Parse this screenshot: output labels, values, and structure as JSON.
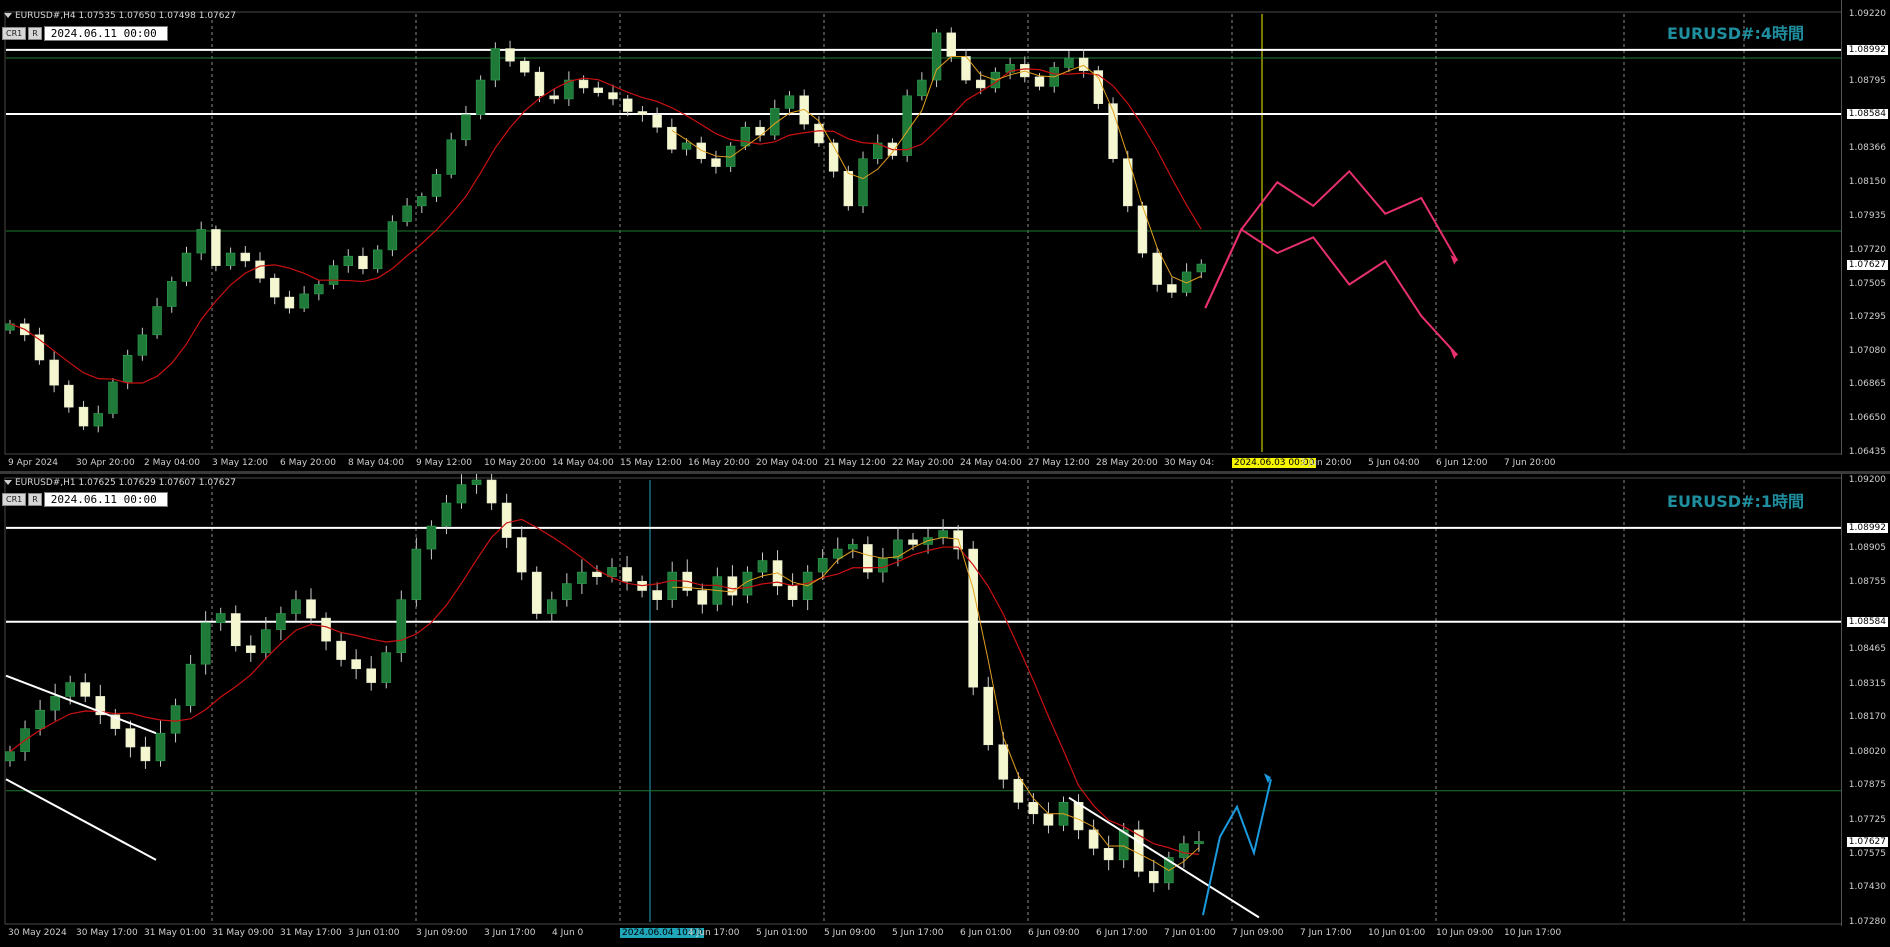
{
  "top": {
    "header": "EURUSD#,H4  1.07535 1.07650 1.07498 1.07627",
    "toolbar": {
      "btn1": "CR1",
      "btn2": "R",
      "date": "2024.06.11 00:00"
    },
    "watermark": "EURUSD#:4時間",
    "price_scale": [
      "1.09220",
      "1.08992",
      "1.08795",
      "1.08584",
      "1.08366",
      "1.08150",
      "1.07935",
      "1.07720",
      "1.07627",
      "1.07505",
      "1.07295",
      "1.07080",
      "1.06865",
      "1.06650",
      "1.06435"
    ],
    "current_price": "1.07627",
    "time_axis": [
      "9 Apr 2024",
      "30 Apr 20:00",
      "2 May 04:00",
      "3 May 12:00",
      "6 May 20:00",
      "8 May 04:00",
      "9 May 12:00",
      "10 May 20:00",
      "14 May 04:00",
      "15 May 12:00",
      "16 May 20:00",
      "20 May 04:00",
      "21 May 12:00",
      "22 May 20:00",
      "24 May 04:00",
      "27 May 12:00",
      "28 May 20:00",
      "30 May 04:",
      "2024.06.03 00:00",
      "3 Jun 20:00",
      "5 Jun 04:00",
      "6 Jun 12:00",
      "7 Jun 20:00"
    ],
    "highlight_label": "2024.06.03 00:00",
    "colors": {
      "highlight": "#f5f500",
      "ma": "#cc1111",
      "forecast": "#e8306e",
      "white_line": "#ffffff",
      "green_line": "#1e7a2e"
    }
  },
  "bottom": {
    "header": "EURUSD#,H1  1.07625 1.07629 1.07607 1.07627",
    "toolbar": {
      "btn1": "CR1",
      "btn2": "R",
      "date": "2024.06.11 00:00"
    },
    "watermark": "EURUSD#:1時間",
    "price_scale": [
      "1.09200",
      "1.08992",
      "1.08905",
      "1.08755",
      "1.08584",
      "1.08465",
      "1.08315",
      "1.08170",
      "1.08020",
      "1.07875",
      "1.07725",
      "1.07627",
      "1.07575",
      "1.07430",
      "1.07280"
    ],
    "current_price": "1.07627",
    "time_axis": [
      "30 May 2024",
      "30 May 17:00",
      "31 May 01:00",
      "31 May 09:00",
      "31 May 17:00",
      "3 Jun 01:00",
      "3 Jun 09:00",
      "3 Jun 17:00",
      "4 Jun 0",
      "2024.06.04 10:00",
      "4 Jun 17:00",
      "5 Jun 01:00",
      "5 Jun 09:00",
      "5 Jun 17:00",
      "6 Jun 01:00",
      "6 Jun 09:00",
      "6 Jun 17:00",
      "7 Jun 01:00",
      "7 Jun 09:00",
      "7 Jun 17:00",
      "10 Jun 01:00",
      "10 Jun 09:00",
      "10 Jun 17:00"
    ],
    "highlight_label": "2024.06.04 10:00",
    "colors": {
      "highlight": "#1fa6b8",
      "ma": "#cc1111",
      "forecast": "#1a9be0",
      "white_line": "#ffffff",
      "green_line": "#1e7a2e"
    }
  },
  "chart_data": [
    {
      "type": "candlestick",
      "title": "EURUSD#:4時間",
      "symbol": "EURUSD#",
      "timeframe": "H4",
      "ohlc_last": {
        "open": 1.07535,
        "high": 1.0765,
        "low": 1.07498,
        "close": 1.07627
      },
      "ylim": [
        1.06435,
        1.0922
      ],
      "horizontal_levels": [
        1.08992,
        1.08584,
        1.0894,
        1.0784
      ],
      "close_series": [
        1.0725,
        1.0718,
        1.0702,
        1.0686,
        1.0672,
        1.066,
        1.0668,
        1.0688,
        1.0705,
        1.0718,
        1.0736,
        1.0752,
        1.077,
        1.0785,
        1.0762,
        1.077,
        1.0765,
        1.0754,
        1.0742,
        1.0735,
        1.0744,
        1.075,
        1.0762,
        1.0768,
        1.076,
        1.0772,
        1.079,
        1.08,
        1.0806,
        1.082,
        1.0842,
        1.0858,
        1.088,
        1.09,
        1.0892,
        1.0885,
        1.087,
        1.0868,
        1.088,
        1.0875,
        1.0872,
        1.0868,
        1.086,
        1.0858,
        1.085,
        1.0836,
        1.084,
        1.083,
        1.0825,
        1.0838,
        1.085,
        1.0845,
        1.0862,
        1.087,
        1.0852,
        1.084,
        1.0822,
        1.08,
        1.083,
        1.084,
        1.0832,
        1.087,
        1.088,
        1.091,
        1.0895,
        1.088,
        1.0875,
        1.0885,
        1.089,
        1.0882,
        1.0876,
        1.0888,
        1.0894,
        1.0886,
        1.0865,
        1.083,
        1.08,
        1.077,
        1.075,
        1.0745,
        1.0758,
        1.0763
      ],
      "forecast_paths": [
        [
          [
            0,
            1.0735
          ],
          [
            1,
            1.0785
          ],
          [
            2,
            1.0815
          ],
          [
            3,
            1.08
          ],
          [
            4,
            1.0822
          ],
          [
            5,
            1.0795
          ],
          [
            6,
            1.0805
          ],
          [
            7,
            1.0765
          ]
        ],
        [
          [
            0,
            1.0735
          ],
          [
            1,
            1.0785
          ],
          [
            2,
            1.077
          ],
          [
            3,
            1.078
          ],
          [
            4,
            1.075
          ],
          [
            5,
            1.0765
          ],
          [
            6,
            1.073
          ],
          [
            7,
            1.0705
          ]
        ]
      ]
    },
    {
      "type": "candlestick",
      "title": "EURUSD#:1時間",
      "symbol": "EURUSD#",
      "timeframe": "H1",
      "ohlc_last": {
        "open": 1.07625,
        "high": 1.07629,
        "low": 1.07607,
        "close": 1.07627
      },
      "ylim": [
        1.0728,
        1.092
      ],
      "horizontal_levels": [
        1.08992,
        1.08584,
        1.0785
      ],
      "close_series": [
        1.0802,
        1.0812,
        1.082,
        1.0826,
        1.0832,
        1.0826,
        1.0818,
        1.0812,
        1.0804,
        1.0798,
        1.081,
        1.0822,
        1.084,
        1.0858,
        1.0862,
        1.0848,
        1.0845,
        1.0855,
        1.0862,
        1.0868,
        1.086,
        1.085,
        1.0842,
        1.0838,
        1.0832,
        1.0845,
        1.0868,
        1.089,
        1.09,
        1.091,
        1.0918,
        1.092,
        1.091,
        1.0895,
        1.088,
        1.0862,
        1.0868,
        1.0875,
        1.088,
        1.0878,
        1.0882,
        1.0876,
        1.0872,
        1.0868,
        1.088,
        1.0872,
        1.0866,
        1.0878,
        1.087,
        1.088,
        1.0885,
        1.0874,
        1.0868,
        1.088,
        1.0886,
        1.089,
        1.0892,
        1.088,
        1.0886,
        1.0894,
        1.0892,
        1.0895,
        1.0898,
        1.089,
        1.083,
        1.0805,
        1.079,
        1.078,
        1.0775,
        1.077,
        1.078,
        1.0768,
        1.076,
        1.0755,
        1.0768,
        1.075,
        1.0745,
        1.0756,
        1.0762,
        1.0763
      ],
      "trendlines": [
        {
          "from": [
            0,
            1.0835
          ],
          "to": [
            1,
            1.081
          ]
        },
        {
          "from": [
            0,
            1.079
          ],
          "to": [
            1,
            1.0755
          ]
        },
        {
          "from": [
            0,
            1.0782
          ],
          "to": [
            1,
            1.073
          ]
        }
      ],
      "forecast_paths": [
        [
          [
            0,
            1.0731
          ],
          [
            1,
            1.0765
          ],
          [
            2,
            1.0778
          ],
          [
            3,
            1.0758
          ],
          [
            4,
            1.079
          ]
        ]
      ]
    }
  ]
}
